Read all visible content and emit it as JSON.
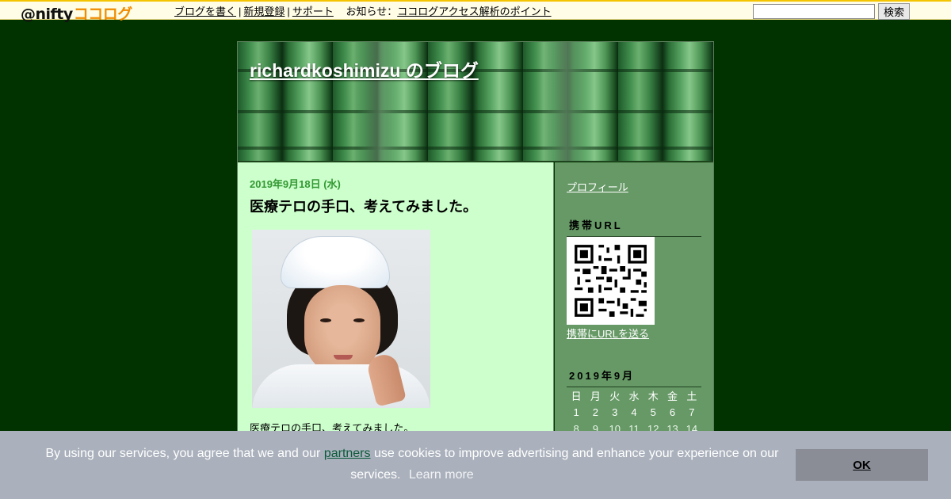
{
  "topbar": {
    "logo_at": "@nifty",
    "logo_kk": "ココログ",
    "links": [
      "ブログを書く",
      "新規登録",
      "サポート"
    ],
    "news_label": "お知らせ",
    "news_colon": "：",
    "news_item": "ココログアクセス解析のポイント",
    "search_value": "",
    "search_button": "検索"
  },
  "blog": {
    "title": "richardkoshimizu のブログ"
  },
  "post": {
    "date": "2019年9月18日 (水)",
    "title": "医療テロの手口、考えてみました。",
    "body": "医療テロの手口、考えてみました。"
  },
  "sidebar": {
    "profile_link": "プロフィール",
    "mobile_heading": "携帯URL",
    "mobile_link": "携帯にURLを送る",
    "calendar_heading": "2019年9月",
    "weekdays": [
      "日",
      "月",
      "火",
      "水",
      "木",
      "金",
      "土"
    ],
    "weeks": [
      [
        "1",
        "2",
        "3",
        "4",
        "5",
        "6",
        "7"
      ],
      [
        "8",
        "9",
        "10",
        "11",
        "12",
        "13",
        "14"
      ]
    ]
  },
  "cookie": {
    "text_before": "By using our services, you agree that we and our",
    "partners_link": "partners",
    "text_after": "use cookies to improve advertising and enhance your experience on our services.",
    "learn_more": "Learn more",
    "ok_button": "OK"
  },
  "colors": {
    "page_bg": "#003300",
    "main_bg": "#ccffcc",
    "sidebar_bg": "#669966",
    "date_color": "#339933"
  }
}
